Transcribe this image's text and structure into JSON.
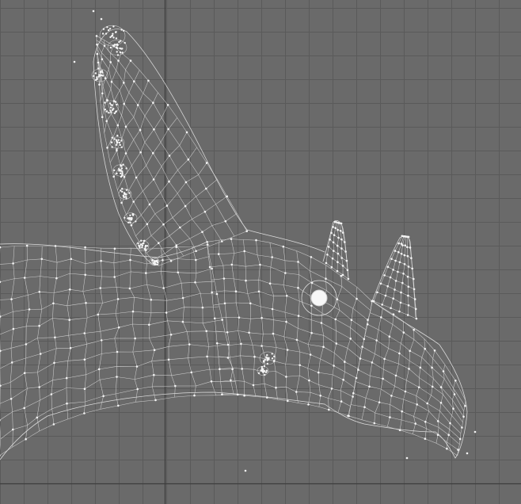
{
  "viewport": {
    "background_color": "#6a6a6a",
    "grid_color": "#5a5a5a",
    "axis_color": "#3d3d3d",
    "wire_color": "#e6e6e6"
  },
  "model": {
    "icon": "selected-vertex-marker"
  }
}
